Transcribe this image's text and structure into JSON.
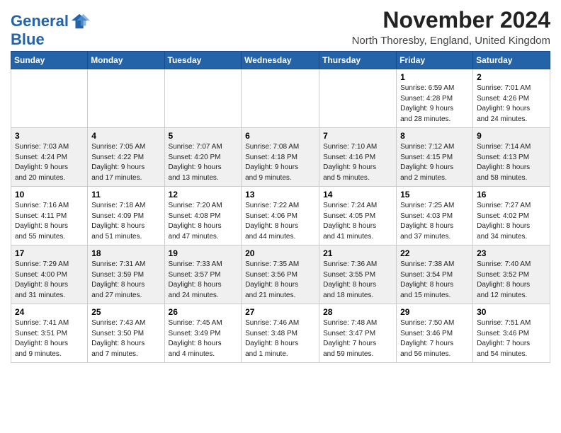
{
  "header": {
    "logo_line1": "General",
    "logo_line2": "Blue",
    "month": "November 2024",
    "location": "North Thoresby, England, United Kingdom"
  },
  "weekdays": [
    "Sunday",
    "Monday",
    "Tuesday",
    "Wednesday",
    "Thursday",
    "Friday",
    "Saturday"
  ],
  "weeks": [
    [
      {
        "day": "",
        "info": ""
      },
      {
        "day": "",
        "info": ""
      },
      {
        "day": "",
        "info": ""
      },
      {
        "day": "",
        "info": ""
      },
      {
        "day": "",
        "info": ""
      },
      {
        "day": "1",
        "info": "Sunrise: 6:59 AM\nSunset: 4:28 PM\nDaylight: 9 hours\nand 28 minutes."
      },
      {
        "day": "2",
        "info": "Sunrise: 7:01 AM\nSunset: 4:26 PM\nDaylight: 9 hours\nand 24 minutes."
      }
    ],
    [
      {
        "day": "3",
        "info": "Sunrise: 7:03 AM\nSunset: 4:24 PM\nDaylight: 9 hours\nand 20 minutes."
      },
      {
        "day": "4",
        "info": "Sunrise: 7:05 AM\nSunset: 4:22 PM\nDaylight: 9 hours\nand 17 minutes."
      },
      {
        "day": "5",
        "info": "Sunrise: 7:07 AM\nSunset: 4:20 PM\nDaylight: 9 hours\nand 13 minutes."
      },
      {
        "day": "6",
        "info": "Sunrise: 7:08 AM\nSunset: 4:18 PM\nDaylight: 9 hours\nand 9 minutes."
      },
      {
        "day": "7",
        "info": "Sunrise: 7:10 AM\nSunset: 4:16 PM\nDaylight: 9 hours\nand 5 minutes."
      },
      {
        "day": "8",
        "info": "Sunrise: 7:12 AM\nSunset: 4:15 PM\nDaylight: 9 hours\nand 2 minutes."
      },
      {
        "day": "9",
        "info": "Sunrise: 7:14 AM\nSunset: 4:13 PM\nDaylight: 8 hours\nand 58 minutes."
      }
    ],
    [
      {
        "day": "10",
        "info": "Sunrise: 7:16 AM\nSunset: 4:11 PM\nDaylight: 8 hours\nand 55 minutes."
      },
      {
        "day": "11",
        "info": "Sunrise: 7:18 AM\nSunset: 4:09 PM\nDaylight: 8 hours\nand 51 minutes."
      },
      {
        "day": "12",
        "info": "Sunrise: 7:20 AM\nSunset: 4:08 PM\nDaylight: 8 hours\nand 47 minutes."
      },
      {
        "day": "13",
        "info": "Sunrise: 7:22 AM\nSunset: 4:06 PM\nDaylight: 8 hours\nand 44 minutes."
      },
      {
        "day": "14",
        "info": "Sunrise: 7:24 AM\nSunset: 4:05 PM\nDaylight: 8 hours\nand 41 minutes."
      },
      {
        "day": "15",
        "info": "Sunrise: 7:25 AM\nSunset: 4:03 PM\nDaylight: 8 hours\nand 37 minutes."
      },
      {
        "day": "16",
        "info": "Sunrise: 7:27 AM\nSunset: 4:02 PM\nDaylight: 8 hours\nand 34 minutes."
      }
    ],
    [
      {
        "day": "17",
        "info": "Sunrise: 7:29 AM\nSunset: 4:00 PM\nDaylight: 8 hours\nand 31 minutes."
      },
      {
        "day": "18",
        "info": "Sunrise: 7:31 AM\nSunset: 3:59 PM\nDaylight: 8 hours\nand 27 minutes."
      },
      {
        "day": "19",
        "info": "Sunrise: 7:33 AM\nSunset: 3:57 PM\nDaylight: 8 hours\nand 24 minutes."
      },
      {
        "day": "20",
        "info": "Sunrise: 7:35 AM\nSunset: 3:56 PM\nDaylight: 8 hours\nand 21 minutes."
      },
      {
        "day": "21",
        "info": "Sunrise: 7:36 AM\nSunset: 3:55 PM\nDaylight: 8 hours\nand 18 minutes."
      },
      {
        "day": "22",
        "info": "Sunrise: 7:38 AM\nSunset: 3:54 PM\nDaylight: 8 hours\nand 15 minutes."
      },
      {
        "day": "23",
        "info": "Sunrise: 7:40 AM\nSunset: 3:52 PM\nDaylight: 8 hours\nand 12 minutes."
      }
    ],
    [
      {
        "day": "24",
        "info": "Sunrise: 7:41 AM\nSunset: 3:51 PM\nDaylight: 8 hours\nand 9 minutes."
      },
      {
        "day": "25",
        "info": "Sunrise: 7:43 AM\nSunset: 3:50 PM\nDaylight: 8 hours\nand 7 minutes."
      },
      {
        "day": "26",
        "info": "Sunrise: 7:45 AM\nSunset: 3:49 PM\nDaylight: 8 hours\nand 4 minutes."
      },
      {
        "day": "27",
        "info": "Sunrise: 7:46 AM\nSunset: 3:48 PM\nDaylight: 8 hours\nand 1 minute."
      },
      {
        "day": "28",
        "info": "Sunrise: 7:48 AM\nSunset: 3:47 PM\nDaylight: 7 hours\nand 59 minutes."
      },
      {
        "day": "29",
        "info": "Sunrise: 7:50 AM\nSunset: 3:46 PM\nDaylight: 7 hours\nand 56 minutes."
      },
      {
        "day": "30",
        "info": "Sunrise: 7:51 AM\nSunset: 3:46 PM\nDaylight: 7 hours\nand 54 minutes."
      }
    ]
  ]
}
